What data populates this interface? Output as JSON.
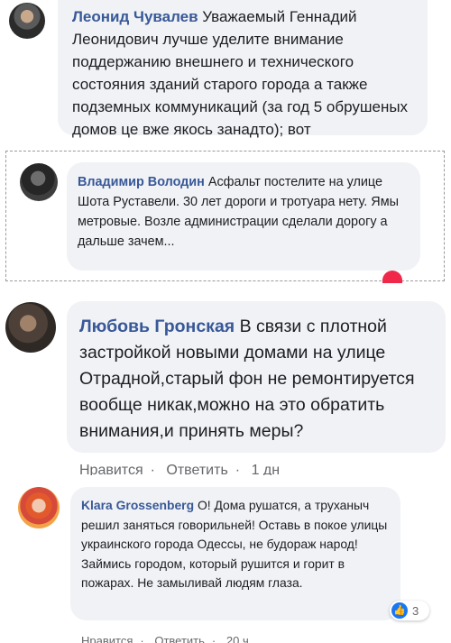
{
  "comments": [
    {
      "author": "Леонид Чувалев",
      "text": "Уважаемый Геннадий Леонидович лучше уделите внимание поддержанию внешнего и технического состояния зданий старого города а также подземных коммуникаций (за год 5 обрушеных домов це вже якось занадто); вот"
    },
    {
      "author": "Владимир Володин",
      "text": "Асфальт постелите на улице Шота Руставели. 30 лет дороги и тротуара нету. Ямы метровые. Возле администрации сделали дорогу а дальше зачем..."
    },
    {
      "author": "Любовь Гронская",
      "text": "В связи с плотной застройкой новыми домами на улице Отрадной,старый фон не ремонтируется вообще никак,можно на это обратить внимания,и принять меры?",
      "actions": {
        "like": "Нравится",
        "reply": "Ответить",
        "time": "1 дн"
      }
    },
    {
      "author": "Klara Grossenberg",
      "text": "О! Дома рушатся, а труханыч решил заняться говорильней! Оставь в покое улицы украинского города Одессы, не будораж народ! Займись городом, который рушится и горит в пожарах. Не замыливай людям глаза.",
      "reactions": {
        "count": "3",
        "icon": "thumbs-up-icon"
      },
      "actions": {
        "like": "Нравится",
        "reply": "Ответить",
        "time": "20 ч"
      }
    }
  ],
  "colors": {
    "author": "#385898",
    "bubble": "#f0f2f5",
    "meta": "#65676b",
    "like": "#1877f2"
  }
}
